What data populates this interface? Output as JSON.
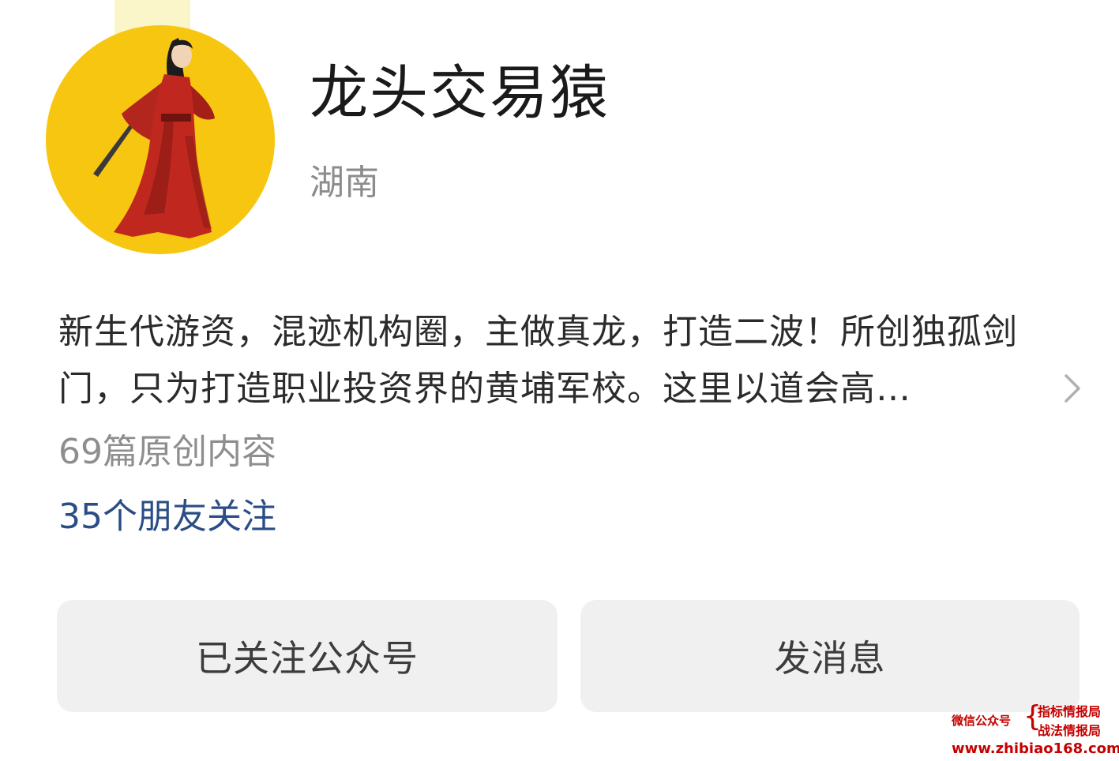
{
  "profile": {
    "name": "龙头交易猿",
    "region": "湖南",
    "intro": "新生代游资，混迹机构圈，主做真龙，打造二波！所创独孤剑门，只为打造职业投资界的黄埔军校。这里以道会高…",
    "articles": "69篇原创内容",
    "friends_following": "35个朋友关注"
  },
  "actions": {
    "followed_label": "已关注公众号",
    "message_label": "发消息"
  },
  "watermark": {
    "wechat_label": "微信公众号",
    "account_1": "指标情报局",
    "account_2": "战法情报局",
    "url": "www.zhibiao168.com"
  },
  "icons": {
    "intro_more": "chevron-right-icon"
  },
  "colors": {
    "avatar_background": "#f7c610",
    "link_blue": "#2b4d85",
    "watermark_red": "#c40000"
  }
}
